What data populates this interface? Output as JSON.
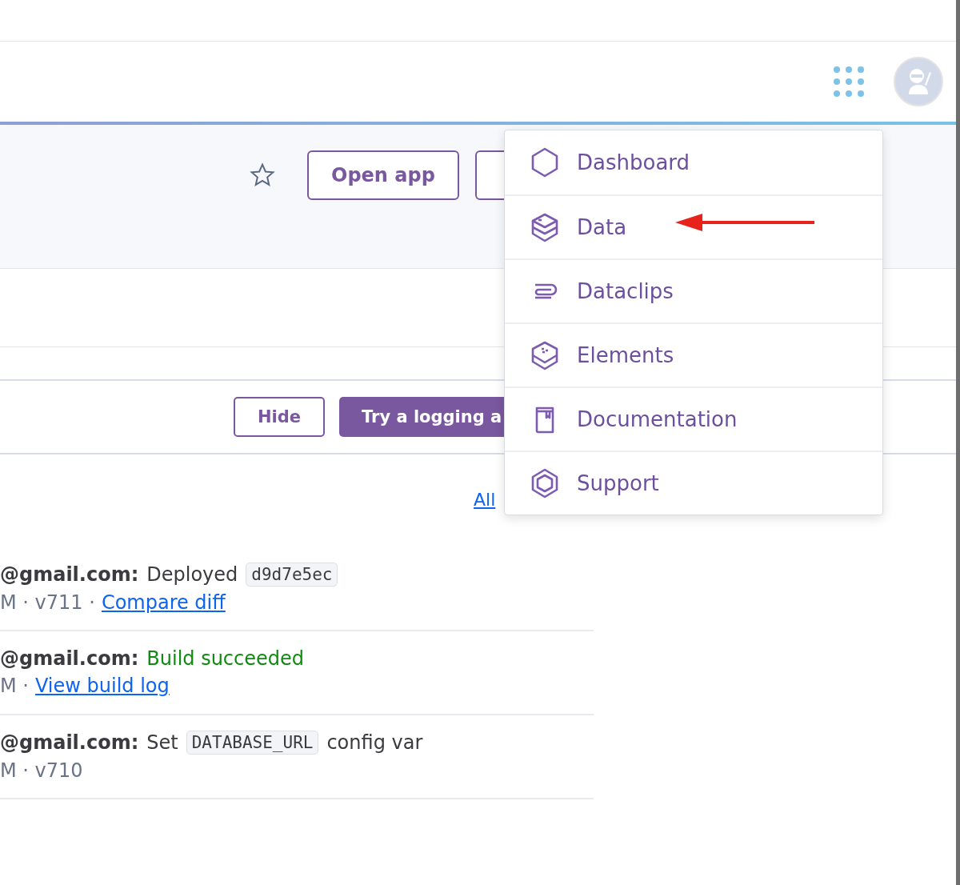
{
  "app_header": {
    "favorite": {
      "selected": false
    },
    "buttons": [
      "Open app"
    ]
  },
  "banner": {
    "buttons": [
      {
        "label": "Hide",
        "primary": false
      },
      {
        "label": "Try a logging a",
        "primary": true
      }
    ]
  },
  "activity": {
    "link": "All",
    "entries": [
      {
        "author": "@gmail.com:",
        "segments": [
          {
            "kind": "text",
            "text": "Deployed"
          },
          {
            "kind": "code",
            "text": "d9d7e5ec"
          }
        ],
        "meta": "M · v711 ·",
        "link": "Compare diff"
      },
      {
        "author": "@gmail.com:",
        "segments": [
          {
            "kind": "success",
            "text": "Build succeeded"
          }
        ],
        "meta": "M ·",
        "link": "View build log"
      },
      {
        "author": "@gmail.com:",
        "segments": [
          {
            "kind": "text",
            "text": "Set"
          },
          {
            "kind": "code",
            "text": "DATABASE_URL"
          },
          {
            "kind": "text",
            "text": "config var"
          }
        ],
        "meta": "M · v710"
      }
    ]
  },
  "menu": {
    "items": [
      {
        "label": "Dashboard",
        "kind": "hexagon"
      },
      {
        "label": "Data",
        "kind": "stack"
      },
      {
        "label": "Dataclips",
        "kind": "clip"
      },
      {
        "label": "Elements",
        "kind": "cube"
      },
      {
        "label": "Documentation",
        "kind": "book"
      },
      {
        "label": "Support",
        "kind": "ring"
      }
    ]
  }
}
